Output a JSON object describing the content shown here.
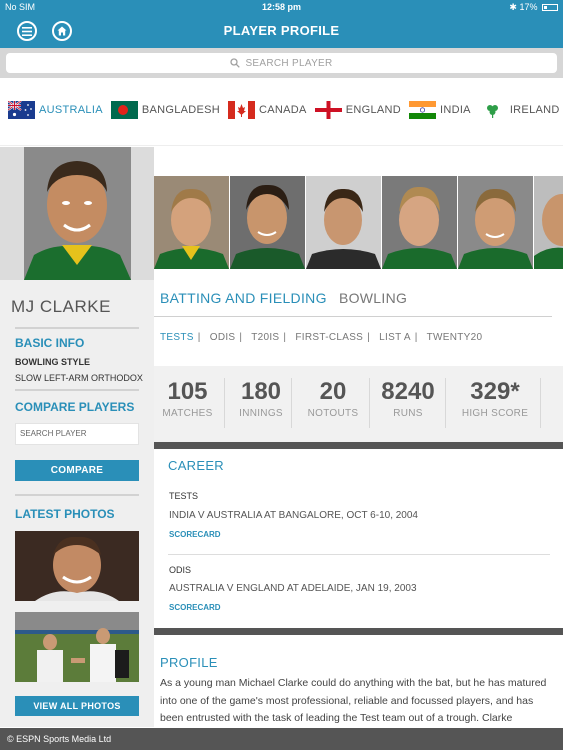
{
  "status_bar": {
    "carrier": "No SIM",
    "time": "12:58 pm",
    "battery": "17%"
  },
  "header": {
    "title": "PLAYER PROFILE"
  },
  "search": {
    "placeholder": "SEARCH PLAYER"
  },
  "countries": [
    {
      "name": "AUSTRALIA",
      "active": true
    },
    {
      "name": "BANGLADESH",
      "active": false
    },
    {
      "name": "CANADA",
      "active": false
    },
    {
      "name": "ENGLAND",
      "active": false
    },
    {
      "name": "INDIA",
      "active": false
    },
    {
      "name": "IRELAND",
      "active": false
    }
  ],
  "player": {
    "name": "MJ CLARKE"
  },
  "sidebar": {
    "basic_info_heading": "BASIC INFO",
    "bowling_style_label": "BOWLING STYLE",
    "bowling_style_value": "SLOW LEFT-ARM ORTHODOX",
    "compare_heading": "COMPARE PLAYERS",
    "compare_placeholder": "SEARCH PLAYER",
    "compare_button": "COMPARE",
    "latest_photos_heading": "LATEST PHOTOS",
    "view_all_photos_button": "VIEW ALL PHOTOS"
  },
  "tabs": {
    "batting": "BATTING AND FIELDING",
    "bowling": "BOWLING"
  },
  "formats": [
    "TESTS",
    "ODIS",
    "T20IS",
    "FIRST-CLASS",
    "LIST A",
    "TWENTY20"
  ],
  "stats": [
    {
      "value": "105",
      "label": "MATCHES"
    },
    {
      "value": "180",
      "label": "INNINGS"
    },
    {
      "value": "20",
      "label": "NOTOUTS"
    },
    {
      "value": "8240",
      "label": "RUNS"
    },
    {
      "value": "329*",
      "label": "HIGH SCORE"
    }
  ],
  "career": {
    "heading": "CAREER",
    "entries": [
      {
        "format": "TESTS",
        "match": "INDIA V AUSTRALIA AT BANGALORE, OCT 6-10, 2004",
        "link": "SCORECARD"
      },
      {
        "format": "ODIS",
        "match": "AUSTRALIA V ENGLAND AT ADELAIDE, JAN 19, 2003",
        "link": "SCORECARD"
      }
    ]
  },
  "profile": {
    "heading": "PROFILE",
    "text": "As a young man Michael Clarke could do anything with the bat, but he has matured into one of the game's most professional, reliable and focussed players, and has been entrusted with the task of leading the Test team out of a trough. Clarke"
  },
  "footer": {
    "copyright": "© ESPN Sports Media Ltd"
  },
  "colors": {
    "accent": "#2a8fb8",
    "footer": "#555555"
  }
}
